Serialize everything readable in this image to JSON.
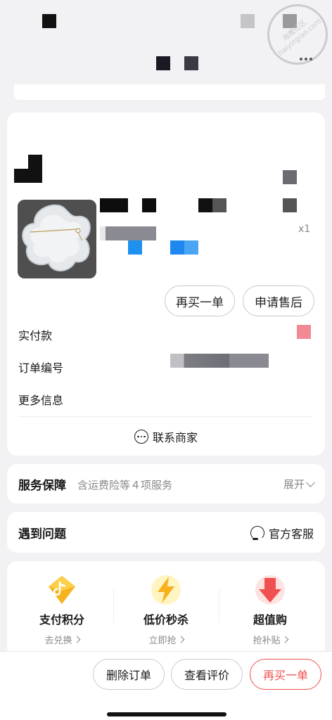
{
  "watermark": {
    "line1": "海鹰社区",
    "line2": "haiyingiao.com"
  },
  "product": {
    "quantity": "x1"
  },
  "order_actions": {
    "buy_again": "再买一单",
    "after_sale": "申请售后"
  },
  "info": {
    "paid_label": "实付款",
    "order_no_label": "订单编号",
    "more_info_label": "更多信息"
  },
  "contact": {
    "label": "联系商家"
  },
  "service": {
    "title": "服务保障",
    "subtitle": "含运费险等４项服务",
    "expand": "展开"
  },
  "problem": {
    "title": "遇到问题",
    "customer_service": "官方客服"
  },
  "promos": [
    {
      "label": "支付积分",
      "action": "去兑换"
    },
    {
      "label": "低价秒杀",
      "action": "立即抢"
    },
    {
      "label": "超值购",
      "action": "抢补贴"
    }
  ],
  "bottom": {
    "delete": "删除订单",
    "review": "查看评价",
    "rebuy": "再买一单"
  },
  "colors": {
    "accent_red": "#f0504f",
    "background": "#f2f2f5"
  }
}
